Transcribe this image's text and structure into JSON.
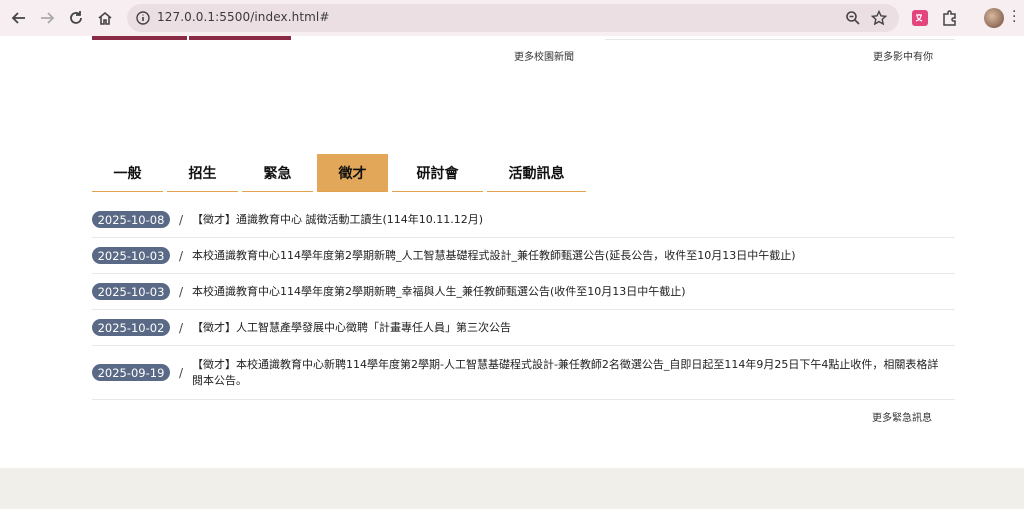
{
  "browser": {
    "url": "127.0.0.1:5500/index.html#"
  },
  "top_links": {
    "more_campus_news": "更多校園新聞",
    "more_in_photos": "更多影中有你"
  },
  "tabs": [
    {
      "label": "一般",
      "active": false
    },
    {
      "label": "招生",
      "active": false
    },
    {
      "label": "緊急",
      "active": false
    },
    {
      "label": "徵才",
      "active": true
    },
    {
      "label": "研討會",
      "active": false
    },
    {
      "label": "活動訊息",
      "active": false
    }
  ],
  "news": [
    {
      "date": "2025-10-08",
      "title": "【徵才】通識教育中心 誠徵活動工讀生(114年10.11.12月)"
    },
    {
      "date": "2025-10-03",
      "title": "本校通識教育中心114學年度第2學期新聘_人工智慧基礎程式設計_兼任教師甄選公告(延長公告，收件至10月13日中午截止)"
    },
    {
      "date": "2025-10-03",
      "title": "本校通識教育中心114學年度第2學期新聘_幸福與人生_兼任教師甄選公告(收件至10月13日中午截止)"
    },
    {
      "date": "2025-10-02",
      "title": "【徵才】人工智慧產學發展中心徵聘「計畫專任人員」第三次公告"
    },
    {
      "date": "2025-09-19",
      "title": "【徵才】本校通識教育中心新聘114學年度第2學期-人工智慧基礎程式設計-兼任教師2名徵選公告_自即日起至114年9月25日下午4點止收件，相關表格詳閱本公告。"
    }
  ],
  "separator": "/",
  "more_urgent": "更多緊急訊息",
  "colors": {
    "active_tab": "#e2a758",
    "tab_underline": "#e2a24f",
    "date_badge": "#5a6a86",
    "accent_bar": "#8b2a45"
  }
}
